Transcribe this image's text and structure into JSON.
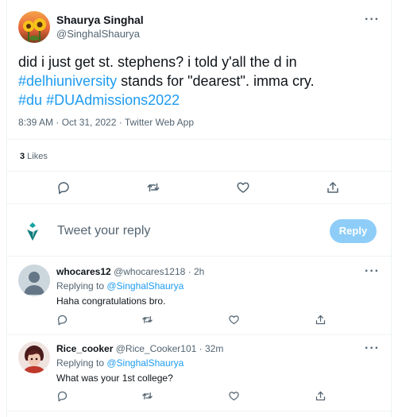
{
  "tweet": {
    "author_name": "Shaurya Singhal",
    "author_handle": "@SinghalShaurya",
    "text_1": "did i just get st. stephens? i told y'all the d in",
    "hashtag_delhiuniversity": "#delhiuniversity",
    "text_2": " stands for \"dearest\". imma cry.",
    "hashtag_du": "#du",
    "hashtag_admissions": "#DUAdmissions2022",
    "timestamp": "8:39 AM · Oct 31, 2022 · Twitter Web App",
    "likes_count": "3",
    "likes_label": " Likes"
  },
  "composer": {
    "placeholder": "Tweet your reply",
    "reply_button": "Reply"
  },
  "replies": [
    {
      "name": "whocares12",
      "handle": "@whocares1218",
      "time": "· 2h",
      "replying_label": "Replying to ",
      "replying_to": "@SinghalShaurya",
      "text": "Haha congratulations bro."
    },
    {
      "name": "Rice_cooker",
      "handle": "@Rice_Cooker101",
      "time": "· 32m",
      "replying_label": "Replying to ",
      "replying_to": "@SinghalShaurya",
      "text": "What was your 1st college?"
    }
  ],
  "icons": {
    "more": "more-horizontal-icon",
    "reply": "reply-icon",
    "retweet": "retweet-icon",
    "like": "heart-icon",
    "share": "share-icon"
  },
  "colors": {
    "accent": "#1d9bf0",
    "reply_button_disabled": "#8ecdf8",
    "secondary_text": "#536471"
  }
}
